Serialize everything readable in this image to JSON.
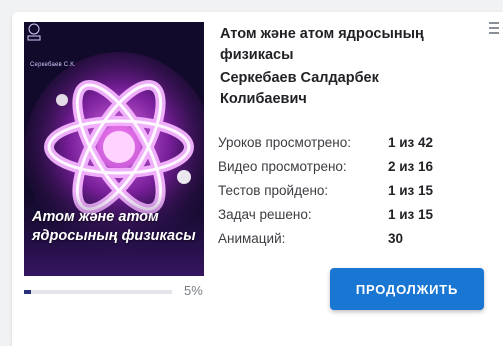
{
  "course": {
    "title": "Атом және атом ядросының физикасы",
    "author": "Серкебаев Салдарбек Колибаевич",
    "cover": {
      "title_text": "Атом және атом ядросының физикасы",
      "author_text": "Серкебаев С.К."
    },
    "progress": {
      "percent": 5,
      "label": "5%"
    }
  },
  "stats": [
    {
      "label": "Уроков просмотрено:",
      "value": "1 из 42"
    },
    {
      "label": "Видео просмотрено:",
      "value": "2 из 16"
    },
    {
      "label": "Тестов пройдено:",
      "value": "1 из 15"
    },
    {
      "label": "Задач решено:",
      "value": "1 из 15"
    },
    {
      "label": "Анимаций:",
      "value": "30"
    }
  ],
  "actions": {
    "continue_label": "ПРОДОЛЖИТЬ"
  },
  "colors": {
    "accent": "#1976d2",
    "progress": "#28307a",
    "cover_bg": "#120a2a",
    "cover_glow": "#e24bff"
  },
  "icons": {
    "menu": "more-vertical-icon",
    "emblem": "university-emblem-icon",
    "atom": "atom-icon"
  }
}
